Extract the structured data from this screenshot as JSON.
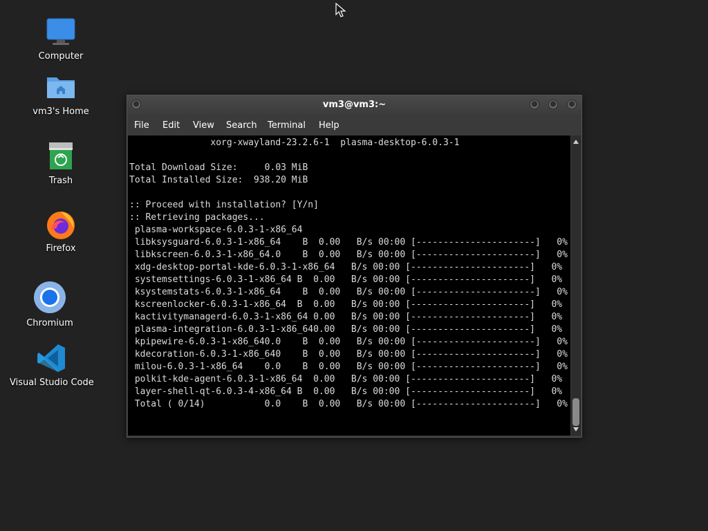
{
  "desktop": {
    "icons": [
      {
        "label": "Computer"
      },
      {
        "label": "vm3's Home"
      },
      {
        "label": "Trash"
      },
      {
        "label": "Firefox"
      },
      {
        "label": "Chromium"
      },
      {
        "label": "Visual Studio Code"
      }
    ]
  },
  "window": {
    "title": "vm3@vm3:~",
    "menu": [
      "File",
      "Edit",
      "View",
      "Search",
      "Terminal",
      "Help"
    ],
    "lines": [
      "               xorg-xwayland-23.2.6-1  plasma-desktop-6.0.3-1",
      "",
      "Total Download Size:     0.03 MiB",
      "Total Installed Size:  938.20 MiB",
      "",
      ":: Proceed with installation? [Y/n]",
      ":: Retrieving packages...",
      " plasma-workspace-6.0.3-1-x86_64",
      " libksysguard-6.0.3-1-x86_64    B  0.00   B/s 00:00 [----------------------]   0%",
      " libkscreen-6.0.3-1-x86_64.0    B  0.00   B/s 00:00 [----------------------]   0%",
      " xdg-desktop-portal-kde-6.0.3-1-x86_64   B/s 00:00 [----------------------]   0%",
      " systemsettings-6.0.3-1-x86_64 B  0.00   B/s 00:00 [----------------------]   0%",
      " ksystemstats-6.0.3-1-x86_64    B  0.00   B/s 00:00 [----------------------]   0%",
      " kscreenlocker-6.0.3-1-x86_64  B  0.00   B/s 00:00 [----------------------]   0%",
      " kactivitymanagerd-6.0.3-1-x86_64 0.00   B/s 00:00 [----------------------]   0%",
      " plasma-integration-6.0.3-1-x86_640.00   B/s 00:00 [----------------------]   0%",
      " kpipewire-6.0.3-1-x86_640.0    B  0.00   B/s 00:00 [----------------------]   0%",
      " kdecoration-6.0.3-1-x86_640    B  0.00   B/s 00:00 [----------------------]   0%",
      " milou-6.0.3-1-x86_64    0.0    B  0.00   B/s 00:00 [----------------------]   0%",
      " polkit-kde-agent-6.0.3-1-x86_64  0.00   B/s 00:00 [----------------------]   0%",
      " layer-shell-qt-6.0.3-4-x86_64 B  0.00   B/s 00:00 [----------------------]   0%",
      " Total ( 0/14)           0.0    B  0.00   B/s 00:00 [----------------------]   0%"
    ]
  }
}
